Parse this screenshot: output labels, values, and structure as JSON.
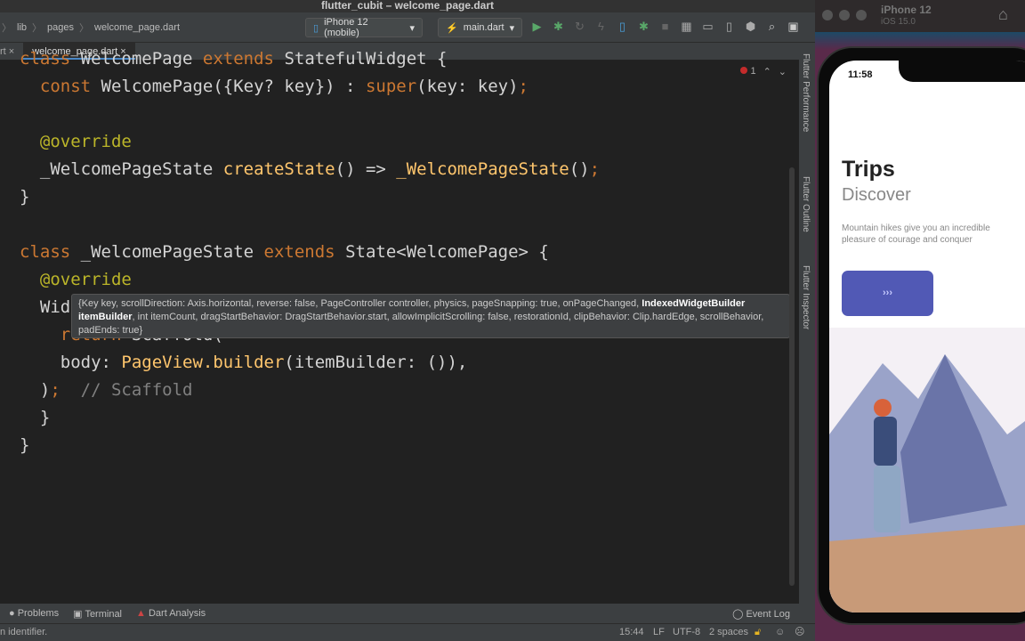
{
  "window": {
    "title": "flutter_cubit – welcome_page.dart"
  },
  "breadcrumb": [
    "lib",
    "pages",
    "welcome_page.dart"
  ],
  "toolbar": {
    "device": "iPhone 12 (mobile)",
    "config": "main.dart"
  },
  "tabs": [
    {
      "label": "rt"
    },
    {
      "label": "welcome_page.dart"
    }
  ],
  "editor": {
    "error_count": "1",
    "lines": [
      [
        [
          "k",
          "class "
        ],
        [
          "w",
          "WelcomePage "
        ],
        [
          "k",
          "extends "
        ],
        [
          "w",
          "StatefulWidget {"
        ]
      ],
      [
        [
          "k",
          "  const "
        ],
        [
          "w",
          "WelcomePage({Key? key}) : "
        ],
        [
          "k",
          "super"
        ],
        [
          "w",
          "(key: key)"
        ],
        [
          "k",
          ";"
        ]
      ],
      [],
      [
        [
          "a",
          "  @override"
        ]
      ],
      [
        [
          "w",
          "  _WelcomePageState "
        ],
        [
          "f",
          "createState"
        ],
        [
          "w",
          "() => "
        ],
        [
          "f",
          "_WelcomePageState"
        ],
        [
          "w",
          "()"
        ],
        [
          "k",
          ";"
        ]
      ],
      [
        [
          "w",
          "}"
        ]
      ],
      [],
      [
        [
          "k",
          "class "
        ],
        [
          "w",
          "_WelcomePageState "
        ],
        [
          "k",
          "extends "
        ],
        [
          "w",
          "State<WelcomePage> {"
        ]
      ],
      [
        [
          "a",
          "  @override"
        ]
      ],
      [
        [
          "w",
          "  Widget "
        ],
        [
          "f",
          "build"
        ],
        [
          "w",
          "(BuildContext context) {"
        ]
      ],
      [
        [
          "k",
          "    return "
        ],
        [
          "w",
          "Scaffold("
        ]
      ],
      [
        [
          "w",
          "    body: "
        ],
        [
          "f",
          "PageView.builder"
        ],
        [
          "w",
          "(itemBuilder: ()),"
        ]
      ],
      [
        [
          "w",
          "  )"
        ],
        [
          "k",
          ";"
        ],
        [
          "c",
          "  // Scaffold"
        ]
      ],
      [
        [
          "w",
          "  }"
        ]
      ],
      [
        [
          "w",
          "}"
        ]
      ]
    ],
    "tooltip": {
      "pre": "{Key key, scrollDirection: Axis.horizontal, reverse: false, PageController controller, physics, pageSnapping: true, onPageChanged, ",
      "bold": "IndexedWidgetBuilder itemBuilder",
      "post": ", int itemCount, dragStartBehavior: DragStartBehavior.start, allowImplicitScrolling: false, restorationId, clipBehavior: Clip.hardEdge, scrollBehavior, padEnds: true}"
    }
  },
  "right_tools": [
    "Flutter Performance",
    "Flutter Outline",
    "Flutter Inspector"
  ],
  "bottom_tools": [
    "Problems",
    "Terminal",
    "Dart Analysis",
    "Event Log"
  ],
  "status": {
    "message": "n identifier.",
    "position": "15:44",
    "line_sep": "LF",
    "encoding": "UTF-8",
    "indent": "2 spaces"
  },
  "simulator": {
    "device": "iPhone 12",
    "os": "iOS 15.0",
    "time": "11:58",
    "title": "Trips",
    "subtitle": "Discover",
    "description": "Mountain hikes give you an incredible pleasure of courage and conquer",
    "button": "›››"
  }
}
